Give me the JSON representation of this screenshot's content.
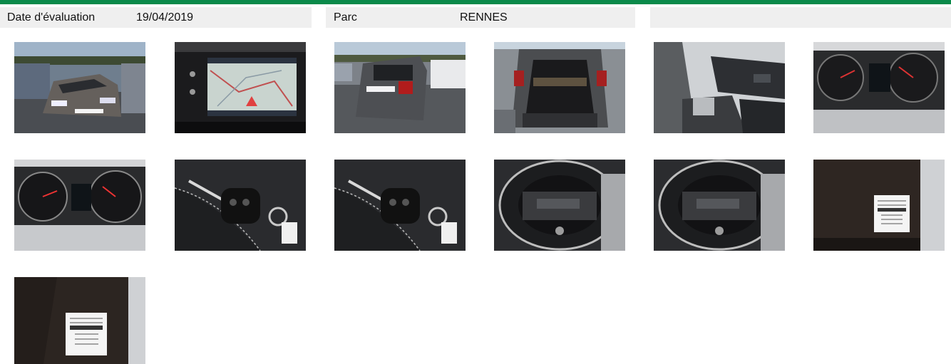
{
  "header": {
    "accent_color": "#0a8a4a",
    "date_label": "Date d'évaluation",
    "date_value": "19/04/2019",
    "parc_label": "Parc",
    "parc_value": "RENNES",
    "third_cell": ""
  },
  "photos": [
    {
      "subject": "exterior front three-quarter view, grey car in parking lot"
    },
    {
      "subject": "infotainment touchscreen showing navigation map"
    },
    {
      "subject": "exterior rear three-quarter view in parking lot"
    },
    {
      "subject": "open trunk / boot interior"
    },
    {
      "subject": "front interior seats and dashboard"
    },
    {
      "subject": "instrument cluster gauges"
    },
    {
      "subject": "instrument cluster gauges (closer)"
    },
    {
      "subject": "folding car key on seat"
    },
    {
      "subject": "folding car key on seat (duplicate)"
    },
    {
      "subject": "spare wheel well with tools"
    },
    {
      "subject": "spare wheel well with tools (duplicate)"
    },
    {
      "subject": "tire pressure / paint label sticker on door frame"
    },
    {
      "subject": "tire pressure / paint label sticker on door frame (closer)"
    }
  ]
}
